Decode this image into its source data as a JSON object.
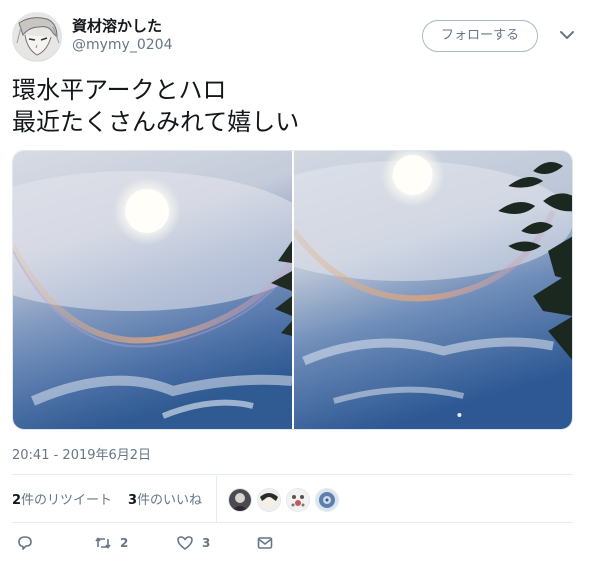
{
  "user": {
    "display_name": "資材溶かした",
    "handle": "@mymy_0204",
    "follow_label": "フォローする"
  },
  "tweet": {
    "text": "環水平アークとハロ\n最近たくさんみれて嬉しい",
    "timestamp": "20:41 - 2019年6月2日"
  },
  "stats": {
    "retweet_count": "2",
    "retweet_label": "件のリツイート",
    "like_count": "3",
    "like_label": "件のいいね"
  },
  "actions": {
    "reply_count": "",
    "retweet_count": "2",
    "like_count": "3"
  },
  "icons": [
    "chevron-down-icon",
    "reply-icon",
    "retweet-icon",
    "heart-icon",
    "message-icon"
  ],
  "colors": {
    "text": "#14171a",
    "secondary": "#657786",
    "border": "#e6ecf0",
    "sky": "#4f79ad"
  }
}
